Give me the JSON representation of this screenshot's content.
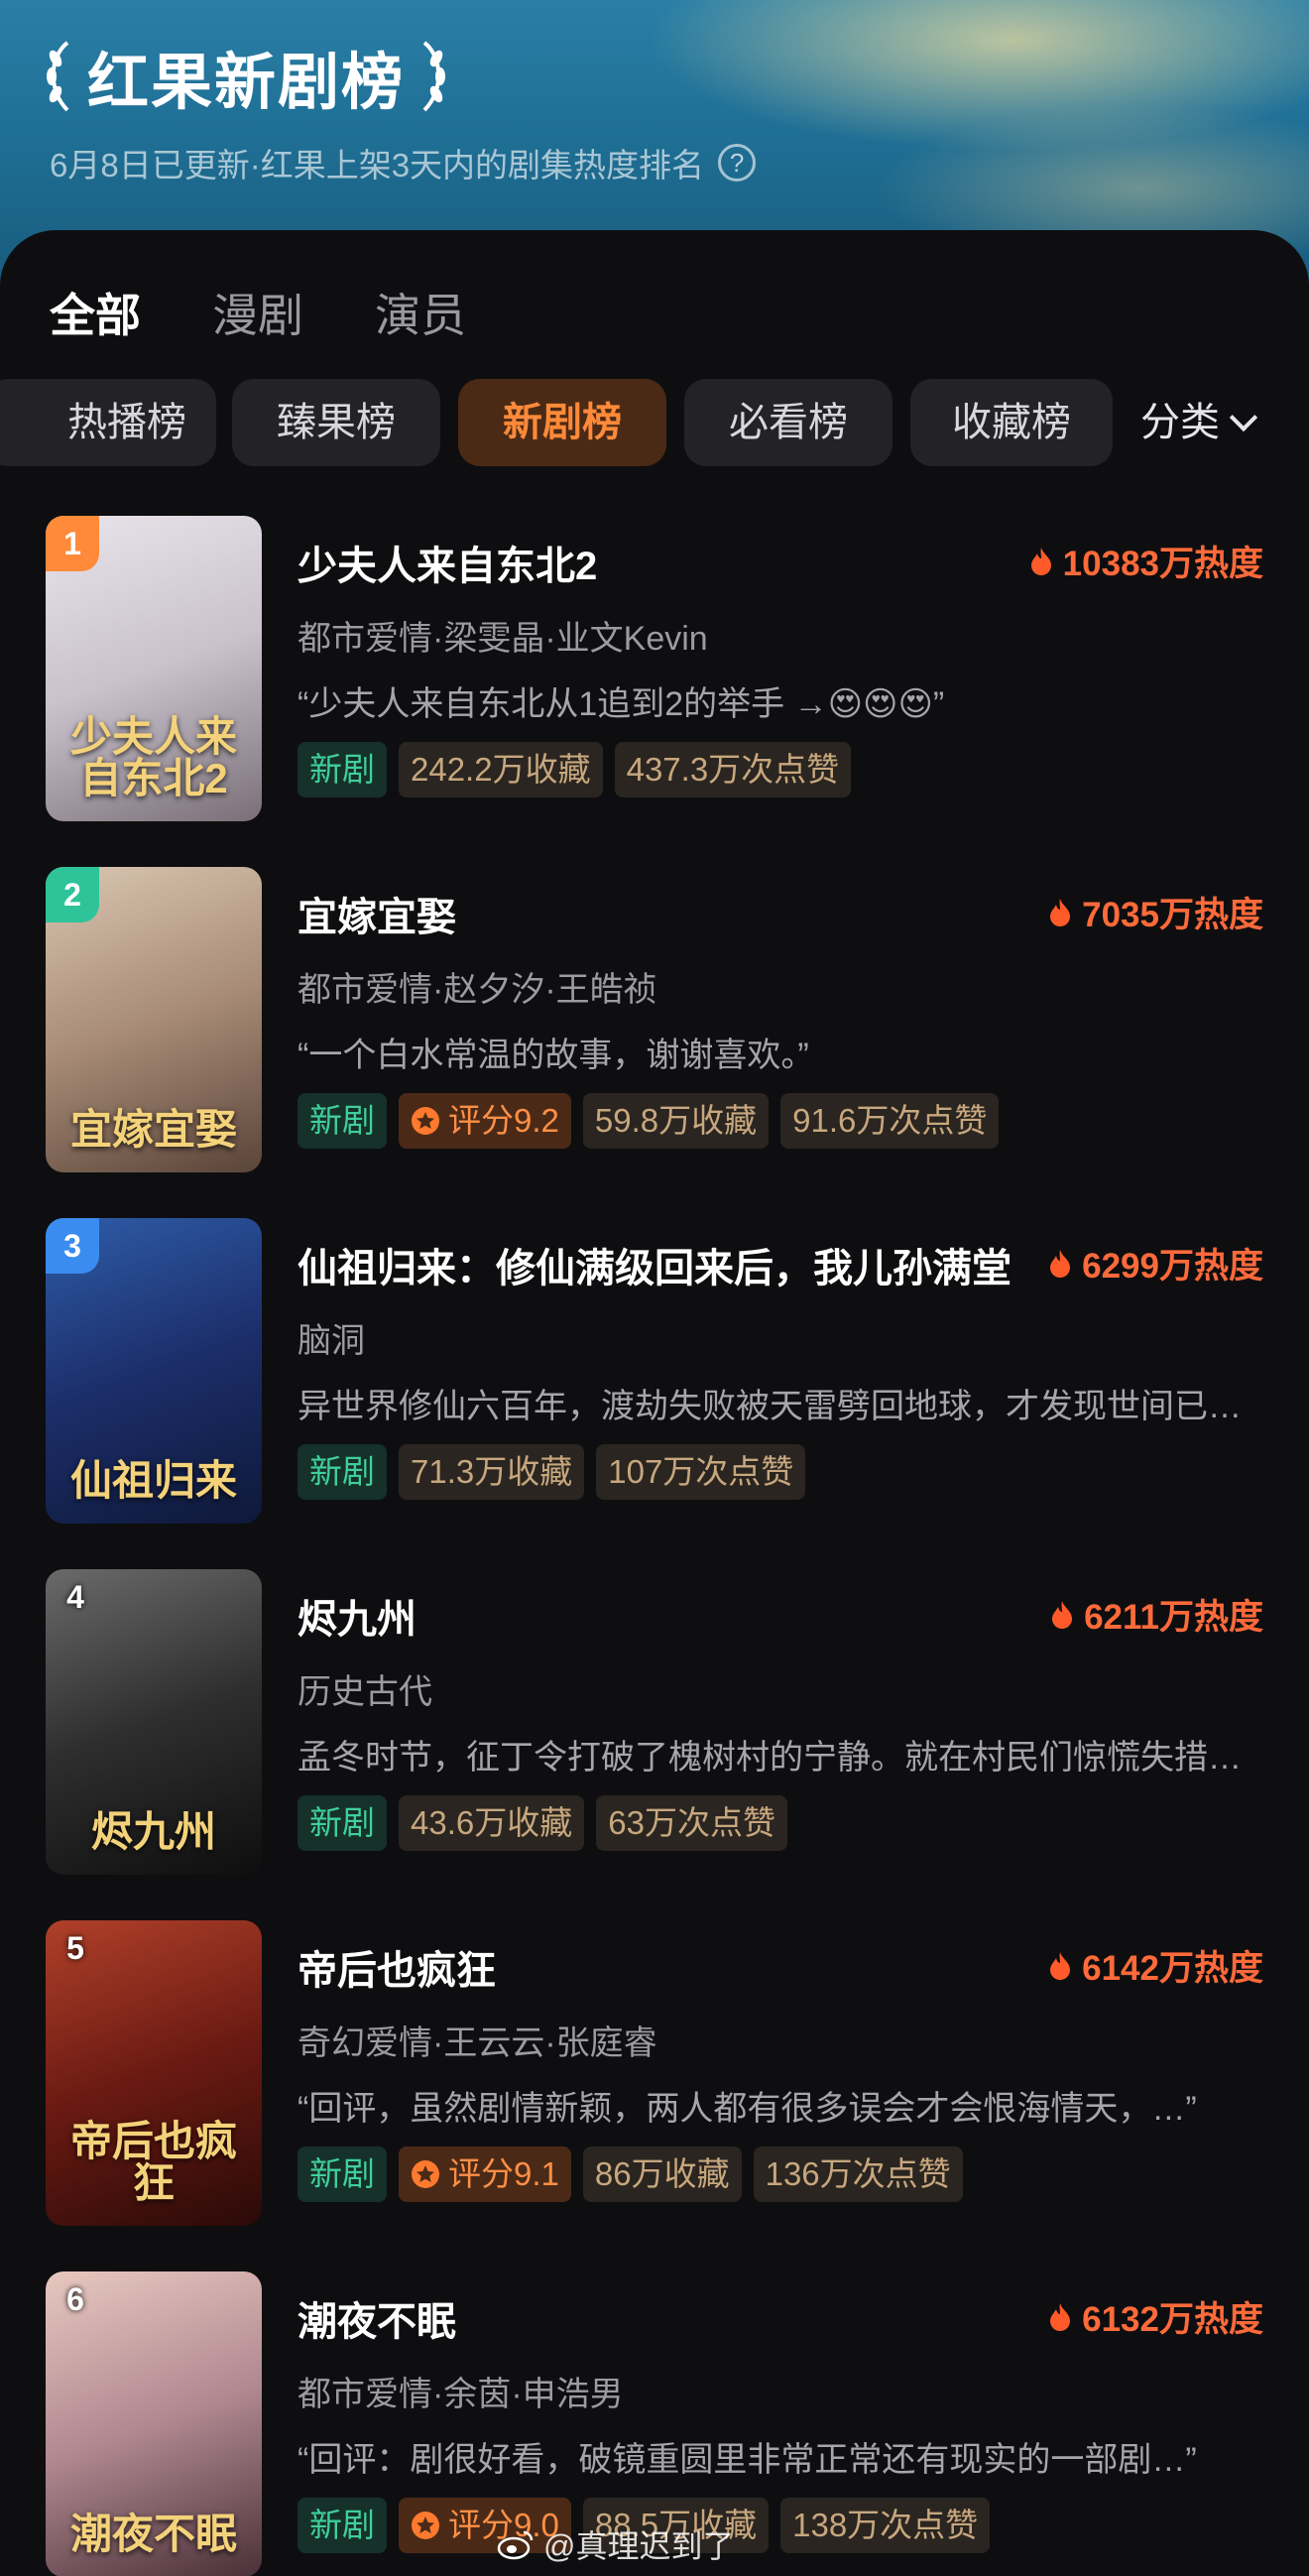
{
  "header": {
    "title": "红果新剧榜",
    "subtitle": "6月8日已更新·红果上架3天内的剧集热度排名",
    "help_glyph": "?"
  },
  "main_tabs": [
    "全部",
    "漫剧",
    "演员"
  ],
  "chips": [
    "热播榜",
    "臻果榜",
    "新剧榜",
    "必看榜",
    "收藏榜"
  ],
  "category_label": "分类",
  "items": [
    {
      "rank": "1",
      "title": "少夫人来自东北2",
      "heat": "10383万热度",
      "meta": "都市爱情·梁雯晶·业文Kevin",
      "quote": "“少夫人来自东北从1追到2的举手 →😍😍😍”",
      "tag_new": "新剧",
      "score": "",
      "favorites": "242.2万收藏",
      "likes": "437.3万次点赞",
      "poster_caption": "少夫人来自东北2",
      "rank_color": "#ff8a3a",
      "poster_colors": [
        "#e9e4ea",
        "#c9c2cc",
        "#7a6f78"
      ]
    },
    {
      "rank": "2",
      "title": "宜嫁宜娶",
      "heat": "7035万热度",
      "meta": "都市爱情·赵夕汐·王皓祯",
      "quote": "“一个白水常温的故事，谢谢喜欢。”",
      "tag_new": "新剧",
      "score": "评分9.2",
      "favorites": "59.8万收藏",
      "likes": "91.6万次点赞",
      "poster_caption": "宜嫁宜娶",
      "rank_color": "#2fc39a",
      "poster_colors": [
        "#d9c6b2",
        "#a88c78",
        "#5a4438"
      ]
    },
    {
      "rank": "3",
      "title": "仙祖归来：修仙满级回来后，我儿孙满堂",
      "heat": "6299万热度",
      "meta": "脑洞",
      "quote": "异世界修仙六百年，渡劫失败被天雷劈回地球，才发现世间已过百年",
      "tag_new": "新剧",
      "score": "",
      "favorites": "71.3万收藏",
      "likes": "107万次点赞",
      "poster_caption": "仙祖归来",
      "rank_color": "#3a8cf0",
      "poster_colors": [
        "#2e5ca8",
        "#1c2e6a",
        "#0e1838"
      ]
    },
    {
      "rank": "4",
      "title": "烬九州",
      "heat": "6211万热度",
      "meta": "历史古代",
      "quote": "孟冬时节，征丁令打破了槐树村的宁静。就在村民们惊慌失措之时",
      "tag_new": "新剧",
      "score": "",
      "favorites": "43.6万收藏",
      "likes": "63万次点赞",
      "poster_caption": "烬九州",
      "rank_color": "transparent",
      "poster_colors": [
        "#6a6a6a",
        "#2e2e2e",
        "#0e0e0e"
      ]
    },
    {
      "rank": "5",
      "title": "帝后也疯狂",
      "heat": "6142万热度",
      "meta": "奇幻爱情·王云云·张庭睿",
      "quote": "“回评，虽然剧情新颖，两人都有很多误会才会恨海情天，…”",
      "tag_new": "新剧",
      "score": "评分9.1",
      "favorites": "86万收藏",
      "likes": "136万次点赞",
      "poster_caption": "帝后也疯狂",
      "rank_color": "transparent",
      "poster_colors": [
        "#b0402a",
        "#6a1a12",
        "#2a0a08"
      ]
    },
    {
      "rank": "6",
      "title": "潮夜不眠",
      "heat": "6132万热度",
      "meta": "都市爱情·余茵·申浩男",
      "quote": "“回评：剧很好看，破镜重圆里非常正常还有现实的一部剧…”",
      "tag_new": "新剧",
      "score": "评分9.0",
      "favorites": "88.5万收藏",
      "likes": "138万次点赞",
      "poster_caption": "潮夜不眠",
      "rank_color": "transparent",
      "poster_colors": [
        "#e8c8c0",
        "#b08890",
        "#4a3038"
      ]
    }
  ],
  "watermark": "@真理迟到了",
  "colors": {
    "accent": "#ff8a3a",
    "heat": "#ff6a3a",
    "new_tag": "#3fcf9a"
  }
}
